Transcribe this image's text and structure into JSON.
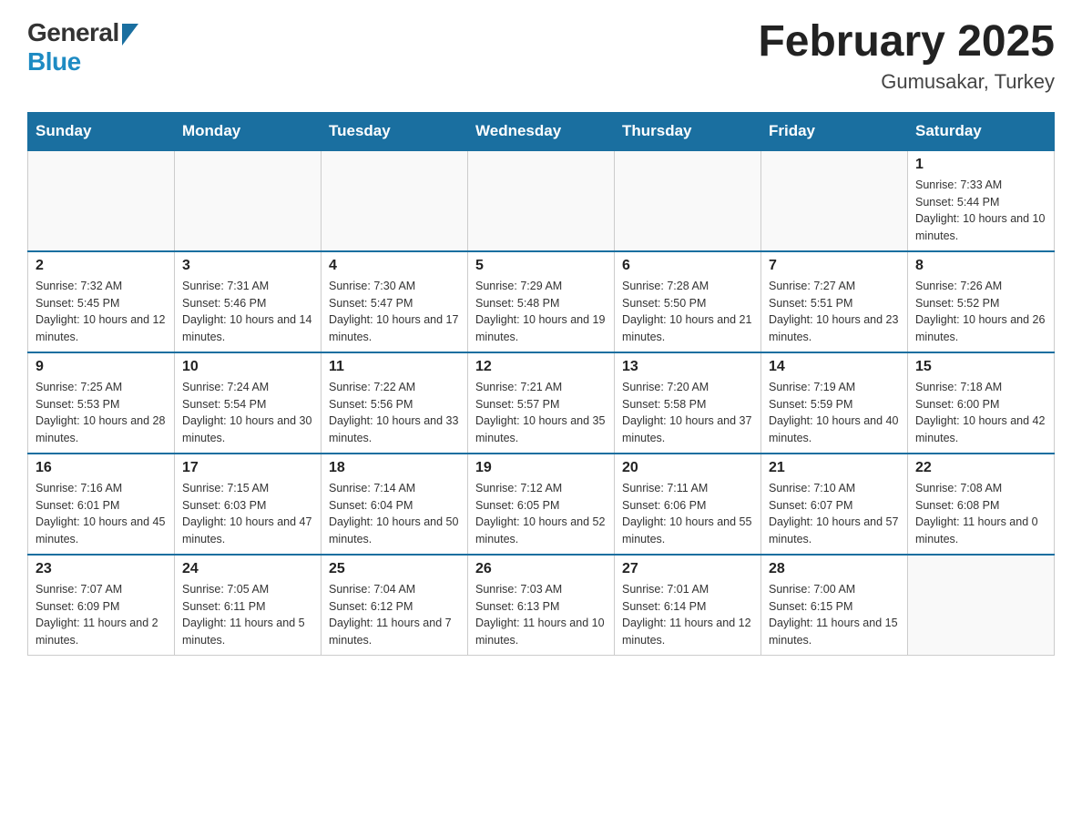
{
  "header": {
    "title": "February 2025",
    "location": "Gumusakar, Turkey",
    "logo_general": "General",
    "logo_blue": "Blue"
  },
  "weekdays": [
    "Sunday",
    "Monday",
    "Tuesday",
    "Wednesday",
    "Thursday",
    "Friday",
    "Saturday"
  ],
  "weeks": [
    [
      {
        "day": "",
        "sunrise": "",
        "sunset": "",
        "daylight": ""
      },
      {
        "day": "",
        "sunrise": "",
        "sunset": "",
        "daylight": ""
      },
      {
        "day": "",
        "sunrise": "",
        "sunset": "",
        "daylight": ""
      },
      {
        "day": "",
        "sunrise": "",
        "sunset": "",
        "daylight": ""
      },
      {
        "day": "",
        "sunrise": "",
        "sunset": "",
        "daylight": ""
      },
      {
        "day": "",
        "sunrise": "",
        "sunset": "",
        "daylight": ""
      },
      {
        "day": "1",
        "sunrise": "Sunrise: 7:33 AM",
        "sunset": "Sunset: 5:44 PM",
        "daylight": "Daylight: 10 hours and 10 minutes."
      }
    ],
    [
      {
        "day": "2",
        "sunrise": "Sunrise: 7:32 AM",
        "sunset": "Sunset: 5:45 PM",
        "daylight": "Daylight: 10 hours and 12 minutes."
      },
      {
        "day": "3",
        "sunrise": "Sunrise: 7:31 AM",
        "sunset": "Sunset: 5:46 PM",
        "daylight": "Daylight: 10 hours and 14 minutes."
      },
      {
        "day": "4",
        "sunrise": "Sunrise: 7:30 AM",
        "sunset": "Sunset: 5:47 PM",
        "daylight": "Daylight: 10 hours and 17 minutes."
      },
      {
        "day": "5",
        "sunrise": "Sunrise: 7:29 AM",
        "sunset": "Sunset: 5:48 PM",
        "daylight": "Daylight: 10 hours and 19 minutes."
      },
      {
        "day": "6",
        "sunrise": "Sunrise: 7:28 AM",
        "sunset": "Sunset: 5:50 PM",
        "daylight": "Daylight: 10 hours and 21 minutes."
      },
      {
        "day": "7",
        "sunrise": "Sunrise: 7:27 AM",
        "sunset": "Sunset: 5:51 PM",
        "daylight": "Daylight: 10 hours and 23 minutes."
      },
      {
        "day": "8",
        "sunrise": "Sunrise: 7:26 AM",
        "sunset": "Sunset: 5:52 PM",
        "daylight": "Daylight: 10 hours and 26 minutes."
      }
    ],
    [
      {
        "day": "9",
        "sunrise": "Sunrise: 7:25 AM",
        "sunset": "Sunset: 5:53 PM",
        "daylight": "Daylight: 10 hours and 28 minutes."
      },
      {
        "day": "10",
        "sunrise": "Sunrise: 7:24 AM",
        "sunset": "Sunset: 5:54 PM",
        "daylight": "Daylight: 10 hours and 30 minutes."
      },
      {
        "day": "11",
        "sunrise": "Sunrise: 7:22 AM",
        "sunset": "Sunset: 5:56 PM",
        "daylight": "Daylight: 10 hours and 33 minutes."
      },
      {
        "day": "12",
        "sunrise": "Sunrise: 7:21 AM",
        "sunset": "Sunset: 5:57 PM",
        "daylight": "Daylight: 10 hours and 35 minutes."
      },
      {
        "day": "13",
        "sunrise": "Sunrise: 7:20 AM",
        "sunset": "Sunset: 5:58 PM",
        "daylight": "Daylight: 10 hours and 37 minutes."
      },
      {
        "day": "14",
        "sunrise": "Sunrise: 7:19 AM",
        "sunset": "Sunset: 5:59 PM",
        "daylight": "Daylight: 10 hours and 40 minutes."
      },
      {
        "day": "15",
        "sunrise": "Sunrise: 7:18 AM",
        "sunset": "Sunset: 6:00 PM",
        "daylight": "Daylight: 10 hours and 42 minutes."
      }
    ],
    [
      {
        "day": "16",
        "sunrise": "Sunrise: 7:16 AM",
        "sunset": "Sunset: 6:01 PM",
        "daylight": "Daylight: 10 hours and 45 minutes."
      },
      {
        "day": "17",
        "sunrise": "Sunrise: 7:15 AM",
        "sunset": "Sunset: 6:03 PM",
        "daylight": "Daylight: 10 hours and 47 minutes."
      },
      {
        "day": "18",
        "sunrise": "Sunrise: 7:14 AM",
        "sunset": "Sunset: 6:04 PM",
        "daylight": "Daylight: 10 hours and 50 minutes."
      },
      {
        "day": "19",
        "sunrise": "Sunrise: 7:12 AM",
        "sunset": "Sunset: 6:05 PM",
        "daylight": "Daylight: 10 hours and 52 minutes."
      },
      {
        "day": "20",
        "sunrise": "Sunrise: 7:11 AM",
        "sunset": "Sunset: 6:06 PM",
        "daylight": "Daylight: 10 hours and 55 minutes."
      },
      {
        "day": "21",
        "sunrise": "Sunrise: 7:10 AM",
        "sunset": "Sunset: 6:07 PM",
        "daylight": "Daylight: 10 hours and 57 minutes."
      },
      {
        "day": "22",
        "sunrise": "Sunrise: 7:08 AM",
        "sunset": "Sunset: 6:08 PM",
        "daylight": "Daylight: 11 hours and 0 minutes."
      }
    ],
    [
      {
        "day": "23",
        "sunrise": "Sunrise: 7:07 AM",
        "sunset": "Sunset: 6:09 PM",
        "daylight": "Daylight: 11 hours and 2 minutes."
      },
      {
        "day": "24",
        "sunrise": "Sunrise: 7:05 AM",
        "sunset": "Sunset: 6:11 PM",
        "daylight": "Daylight: 11 hours and 5 minutes."
      },
      {
        "day": "25",
        "sunrise": "Sunrise: 7:04 AM",
        "sunset": "Sunset: 6:12 PM",
        "daylight": "Daylight: 11 hours and 7 minutes."
      },
      {
        "day": "26",
        "sunrise": "Sunrise: 7:03 AM",
        "sunset": "Sunset: 6:13 PM",
        "daylight": "Daylight: 11 hours and 10 minutes."
      },
      {
        "day": "27",
        "sunrise": "Sunrise: 7:01 AM",
        "sunset": "Sunset: 6:14 PM",
        "daylight": "Daylight: 11 hours and 12 minutes."
      },
      {
        "day": "28",
        "sunrise": "Sunrise: 7:00 AM",
        "sunset": "Sunset: 6:15 PM",
        "daylight": "Daylight: 11 hours and 15 minutes."
      },
      {
        "day": "",
        "sunrise": "",
        "sunset": "",
        "daylight": ""
      }
    ]
  ]
}
